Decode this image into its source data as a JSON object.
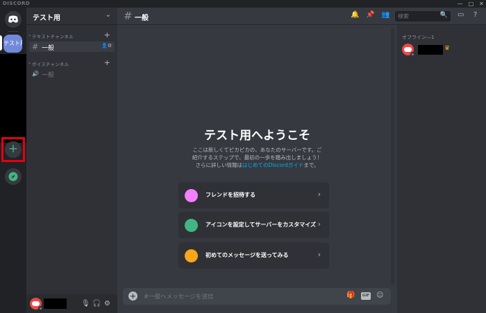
{
  "app": {
    "brand": "DISCORD"
  },
  "window": {
    "minimize": "—",
    "maximize": "□",
    "close": "✕"
  },
  "rail": {
    "active_server": "テスト用",
    "add_server": "+"
  },
  "guild": {
    "name": "テスト用",
    "chevron": "⌄"
  },
  "categories": {
    "text": {
      "label": "テキストチャンネル",
      "arrow": "⌄",
      "plus": "+"
    },
    "voice": {
      "label": "ボイスチャンネル",
      "arrow": "⌄",
      "plus": "+"
    }
  },
  "channels": {
    "text": {
      "hash": "#",
      "name": "一般",
      "icons": "👤⚙"
    },
    "voice": {
      "hash": "🔊",
      "name": "一般"
    }
  },
  "header": {
    "hash": "#",
    "channel": "一般",
    "search_placeholder": "検索",
    "search_icon": "🔍"
  },
  "welcome": {
    "title": "テスト用へようこそ",
    "desc_before": "ここは新しくてピカピカの、あなたのサーバーです。ご紹介するステップで、最初の一歩を踏み出しましょう！さらに詳しい情報は",
    "link": "はじめてのDiscordガイド",
    "desc_after": "まで。"
  },
  "actions": [
    {
      "label": "フレンドを招待する",
      "icon": "invite-icon",
      "color": "#f47fff",
      "chevron": "›"
    },
    {
      "label": "アイコンを設定してサーバーをカスタマイズ",
      "icon": "customize-icon",
      "color": "#43b581",
      "chevron": "›"
    },
    {
      "label": "初めてのメッセージを送ってみる",
      "icon": "message-icon",
      "color": "#faa61a",
      "chevron": "›"
    }
  ],
  "composer": {
    "placeholder": "#一般へメッセージを送信",
    "plus": "+",
    "gif": "GIF"
  },
  "members": {
    "category": "オフライン—1"
  },
  "colors": {
    "blurple": "#7289da",
    "green": "#43b581",
    "red": "#f04747",
    "highlight": "#e60012"
  }
}
